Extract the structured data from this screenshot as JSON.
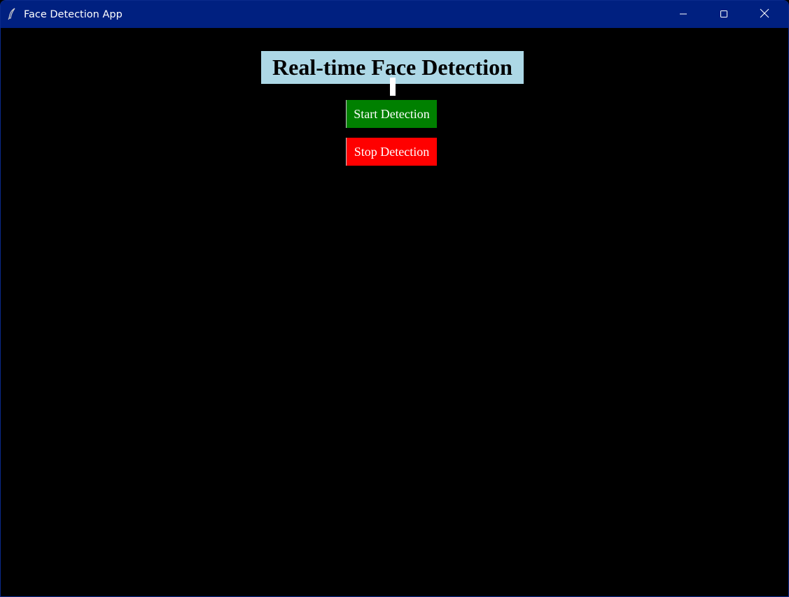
{
  "window": {
    "title": "Face Detection App",
    "app_icon": "feather-icon",
    "controls": {
      "minimize_icon": "minimize-icon",
      "maximize_icon": "maximize-icon",
      "close_icon": "close-icon"
    }
  },
  "main": {
    "heading": "Real-time Face Detection",
    "start_button_label": "Start Detection",
    "stop_button_label": "Stop Detection"
  },
  "colors": {
    "titlebar": "#002080",
    "background": "#000000",
    "heading_background": "#add8e6",
    "start_button": "#008000",
    "stop_button": "#ff0000",
    "video_label": "#ffffff"
  }
}
